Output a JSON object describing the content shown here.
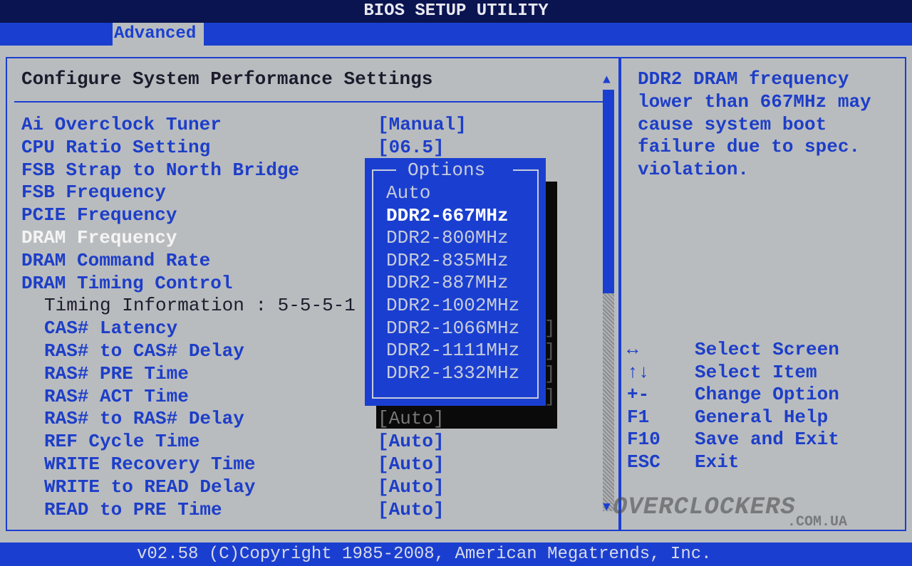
{
  "title": "BIOS SETUP UTILITY",
  "tabs": [
    {
      "label": "Advanced",
      "active": true
    }
  ],
  "section_title": "Configure System Performance Settings",
  "settings": [
    {
      "label": "Ai Overclock Tuner",
      "value": "[Manual]",
      "indent": false
    },
    {
      "label": "CPU Ratio Setting",
      "value": "[06.5]",
      "indent": false
    },
    {
      "label": "FSB Strap to North Bridge",
      "value": "",
      "indent": false
    },
    {
      "label": "FSB Frequency",
      "value": "",
      "indent": false
    },
    {
      "label": "PCIE Frequency",
      "value": "",
      "indent": false
    },
    {
      "label": "DRAM Frequency",
      "value": "",
      "indent": false,
      "selected": true
    },
    {
      "label": "DRAM Command Rate",
      "value": "",
      "indent": false
    },
    {
      "label": "DRAM Timing Control",
      "value": "",
      "indent": false
    },
    {
      "label": "Timing Information : 5-5-5-1",
      "value": "",
      "indent": true,
      "static": true
    },
    {
      "label": "CAS# Latency",
      "value": "]",
      "indent": true
    },
    {
      "label": "RAS# to CAS# Delay",
      "value": "]",
      "indent": true
    },
    {
      "label": "RAS# PRE Time",
      "value": "]",
      "indent": true
    },
    {
      "label": "RAS# ACT Time",
      "value": "]",
      "indent": true
    },
    {
      "label": "RAS# to RAS# Delay",
      "value": "[Auto]",
      "indent": true,
      "shadowed": true
    },
    {
      "label": "REF Cycle Time",
      "value": "[Auto]",
      "indent": true
    },
    {
      "label": "WRITE Recovery Time",
      "value": "[Auto]",
      "indent": true
    },
    {
      "label": "WRITE to READ Delay",
      "value": "[Auto]",
      "indent": true
    },
    {
      "label": "READ to PRE Time",
      "value": "[Auto]",
      "indent": true
    }
  ],
  "options_popup": {
    "title": "Options",
    "items": [
      "Auto",
      "DDR2-667MHz",
      "DDR2-800MHz",
      "DDR2-835MHz",
      "DDR2-887MHz",
      "DDR2-1002MHz",
      "DDR2-1066MHz",
      "DDR2-1111MHz",
      "DDR2-1332MHz"
    ],
    "highlighted": "DDR2-667MHz"
  },
  "help_text": [
    "DDR2 DRAM frequency",
    "lower than 667MHz may",
    "cause system boot",
    "failure due to spec.",
    "violation."
  ],
  "key_legend": [
    {
      "key": "↔",
      "action": "Select Screen"
    },
    {
      "key": "↑↓",
      "action": "Select Item"
    },
    {
      "key": "+-",
      "action": "Change Option"
    },
    {
      "key": "F1",
      "action": "General Help"
    },
    {
      "key": "F10",
      "action": "Save and Exit"
    },
    {
      "key": "ESC",
      "action": "Exit"
    }
  ],
  "footer": "v02.58 (C)Copyright 1985-2008, American Megatrends, Inc.",
  "watermark": {
    "main": "OVERCLOCKERS",
    "sub": ".COM.UA"
  },
  "icons": {
    "scroll_up": "triangle-up",
    "scroll_down": "triangle-down"
  },
  "colors": {
    "background": "#b9bcbf",
    "accent": "#1a3fd0",
    "title_bar": "#0a1450",
    "selected_text": "#f4f4f4"
  }
}
